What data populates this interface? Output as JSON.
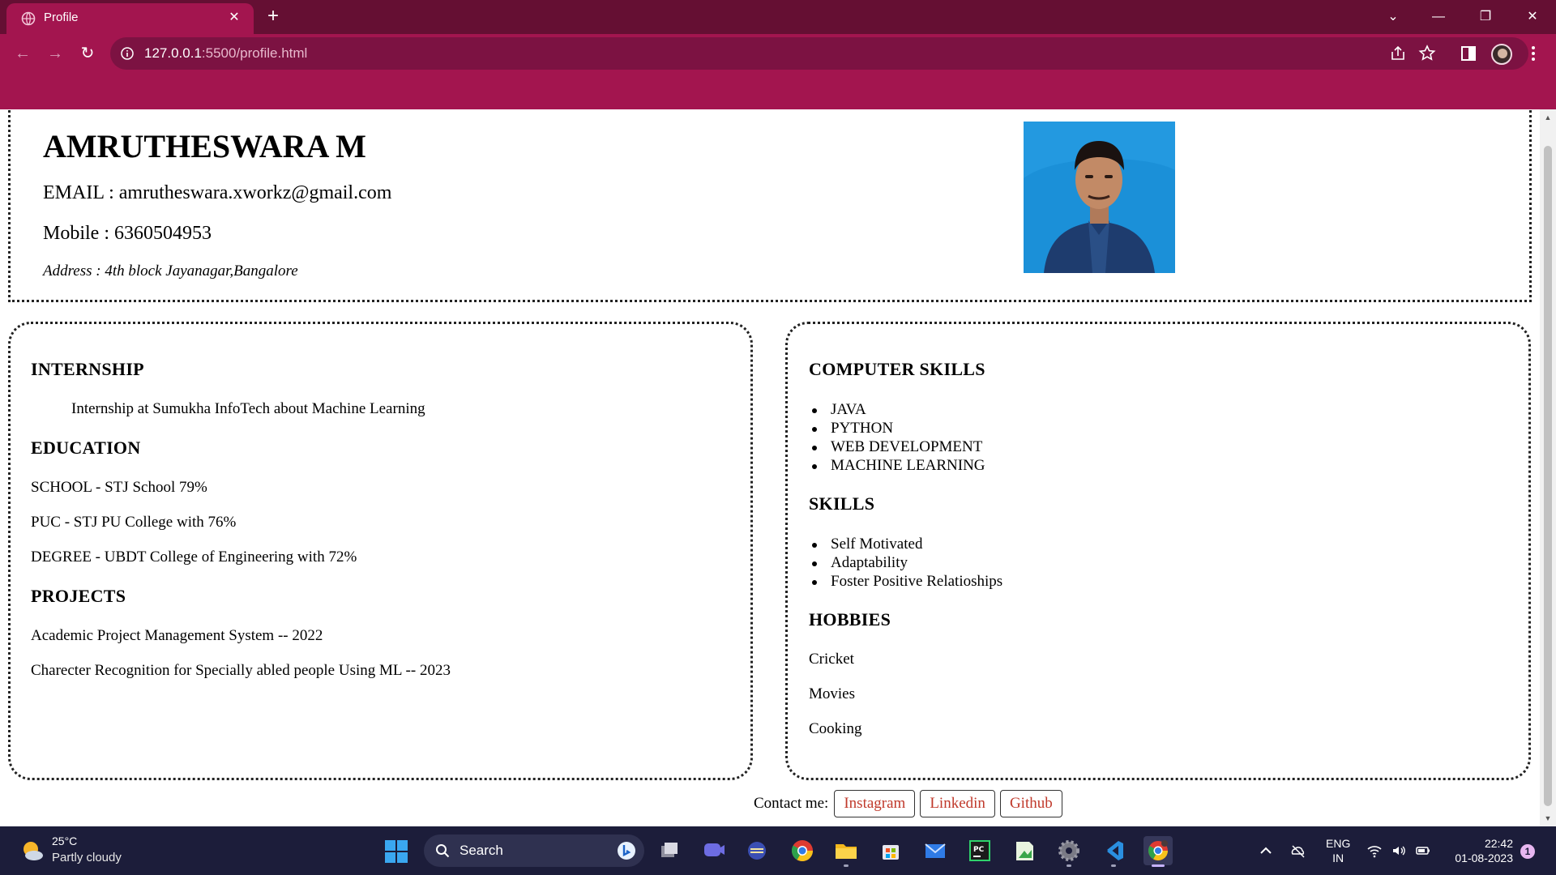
{
  "browser": {
    "tab_title": "Profile",
    "url_host": "127.0.0.1",
    "url_path": ":5500/profile.html"
  },
  "profile": {
    "name": "AMRUTHESWARA M",
    "email": "EMAIL : amrutheswara.xworkz@gmail.com",
    "mobile": "Mobile : 6360504953",
    "address": "Address : 4th block Jayanagar,Bangalore"
  },
  "left_card": {
    "internship_heading": "INTERNSHIP",
    "internship_text": "Internship at Sumukha InfoTech about Machine Learning",
    "education_heading": "EDUCATION",
    "education": [
      "SCHOOL - STJ School 79%",
      "PUC - STJ PU College with 76%",
      "DEGREE - UBDT College of Engineering with 72%"
    ],
    "projects_heading": "PROJECTS",
    "projects": [
      "Academic Project Management System -- 2022",
      "Charecter Recognition for Specially abled people Using ML -- 2023"
    ]
  },
  "right_card": {
    "computer_skills_heading": "COMPUTER SKILLS",
    "computer_skills": [
      "JAVA",
      "PYTHON",
      "WEB DEVELOPMENT",
      "MACHINE LEARNING"
    ],
    "skills_heading": "SKILLS",
    "skills": [
      "Self Motivated",
      "Adaptability",
      "Foster Positive Relatioships"
    ],
    "hobbies_heading": "HOBBIES",
    "hobbies": [
      "Cricket",
      "Movies",
      "Cooking"
    ]
  },
  "contact": {
    "label": "Contact me:",
    "links": [
      "Instagram",
      "Linkedin",
      "Github"
    ]
  },
  "taskbar": {
    "weather_temp": "25°C",
    "weather_desc": "Partly cloudy",
    "search_label": "Search",
    "lang_line1": "ENG",
    "lang_line2": "IN",
    "time": "22:42",
    "date": "01-08-2023",
    "notification_count": "1"
  },
  "colors": {
    "chrome_dark": "#650f33",
    "chrome_accent": "#a3154f",
    "link_red": "#c0392b",
    "taskbar_bg": "#1c1d3a"
  }
}
